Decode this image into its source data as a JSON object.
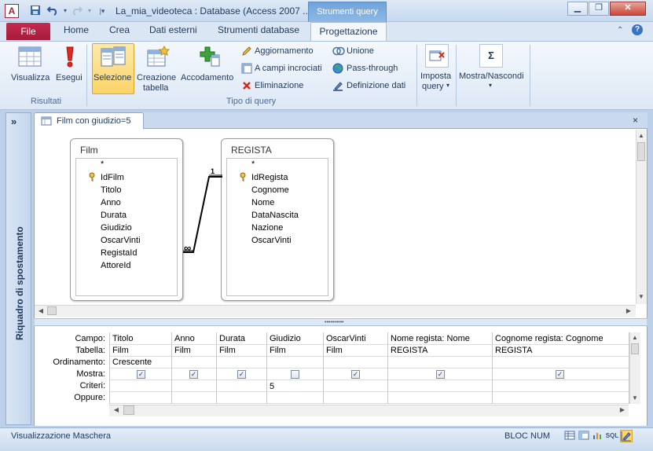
{
  "window": {
    "title": "La_mia_videoteca : Database (Access 2007 ...",
    "context_tab_group": "Strumenti query",
    "app_icon": "A",
    "minimize_icon": "minimize-icon",
    "maximize_icon": "restore-icon",
    "close_icon": "close-icon"
  },
  "ribbon": {
    "tabs": [
      "File",
      "Home",
      "Crea",
      "Dati esterni",
      "Strumenti database",
      "Progettazione"
    ],
    "groups": {
      "risultati": {
        "label": "Risultati",
        "visualizza": "Visualizza",
        "esegui": "Esegui"
      },
      "tipo_query": {
        "label": "Tipo di query",
        "selezione": "Selezione",
        "creazione_tabella_1": "Creazione",
        "creazione_tabella_2": "tabella",
        "accodamento": "Accodamento",
        "aggiornamento": "Aggiornamento",
        "campi_incrociati": "A campi incrociati",
        "eliminazione": "Eliminazione",
        "unione": "Unione",
        "pass_through": "Pass-through",
        "definizione_dati": "Definizione dati"
      },
      "imposta_query_1": "Imposta",
      "imposta_query_2": "query",
      "mostra_nascondi": "Mostra/Nascondi",
      "sigma": "Σ"
    }
  },
  "nav_pane": {
    "label": "Riquadro di spostamento",
    "toggle": "»"
  },
  "document": {
    "tab_title": "Film con giudizio=5",
    "close": "×"
  },
  "tables": [
    {
      "name": "Film",
      "fields": [
        "*",
        "IdFilm",
        "Titolo",
        "Anno",
        "Durata",
        "Giudizio",
        "OscarVinti",
        "RegistaId",
        "AttoreId"
      ],
      "key_field": "IdFilm"
    },
    {
      "name": "REGISTA",
      "fields": [
        "*",
        "IdRegista",
        "Cognome",
        "Nome",
        "DataNascita",
        "Nazione",
        "OscarVinti"
      ],
      "key_field": "IdRegista"
    }
  ],
  "relationship": {
    "one_side": "1",
    "many_side": "∞"
  },
  "grid": {
    "row_labels": [
      "Campo:",
      "Tabella:",
      "Ordinamento:",
      "Mostra:",
      "Criteri:",
      "Oppure:"
    ],
    "columns": [
      {
        "campo": "Titolo",
        "tabella": "Film",
        "ordinamento": "Crescente",
        "mostra": true,
        "criteri": ""
      },
      {
        "campo": "Anno",
        "tabella": "Film",
        "ordinamento": "",
        "mostra": true,
        "criteri": ""
      },
      {
        "campo": "Durata",
        "tabella": "Film",
        "ordinamento": "",
        "mostra": true,
        "criteri": ""
      },
      {
        "campo": "Giudizio",
        "tabella": "Film",
        "ordinamento": "",
        "mostra": false,
        "criteri": "5"
      },
      {
        "campo": "OscarVinti",
        "tabella": "Film",
        "ordinamento": "",
        "mostra": true,
        "criteri": ""
      },
      {
        "campo": "Nome regista: Nome",
        "tabella": "REGISTA",
        "ordinamento": "",
        "mostra": true,
        "criteri": ""
      },
      {
        "campo": "Cognome regista: Cognome",
        "tabella": "REGISTA",
        "ordinamento": "",
        "mostra": true,
        "criteri": ""
      }
    ]
  },
  "status": {
    "left": "Visualizzazione Maschera",
    "num_lock": "BLOC NUM",
    "sql": "SQL"
  }
}
